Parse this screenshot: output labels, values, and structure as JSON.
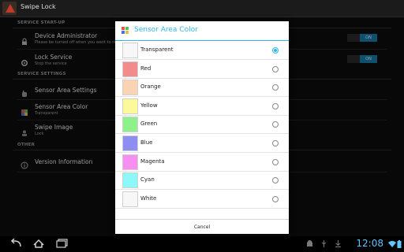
{
  "actionbar": {
    "title": "Swipe Lock"
  },
  "settings": {
    "sections": [
      {
        "label": "SERVICE START-UP"
      },
      {
        "label": "SERVICE SETTINGS"
      },
      {
        "label": "OTHER"
      }
    ],
    "items": [
      {
        "title": "Device Administrator",
        "summary": "Please be turned off when you want to re",
        "toggle": "ON",
        "icon": "lock-icon"
      },
      {
        "title": "Lock Service",
        "summary": "Stop the service",
        "toggle": "ON",
        "icon": "gear-icon"
      },
      {
        "title": "Sensor Area Settings",
        "summary": "",
        "icon": "hand-icon"
      },
      {
        "title": "Sensor Area Color",
        "summary": "Transparent",
        "icon": "palette-icon"
      },
      {
        "title": "Swipe Image",
        "summary": "Lock",
        "icon": "image-icon"
      },
      {
        "title": "Version Information",
        "summary": "",
        "icon": "info-icon"
      }
    ]
  },
  "dialog": {
    "title": "Sensor Area Color",
    "icon": "palette-icon",
    "cancel_label": "Cancel",
    "options": [
      {
        "label": "Transparent",
        "color": "#f7f7f7",
        "selected": true
      },
      {
        "label": "Red",
        "color": "#f28b8b",
        "selected": false
      },
      {
        "label": "Orange",
        "color": "#f9d3b3",
        "selected": false
      },
      {
        "label": "Yellow",
        "color": "#fbf99a",
        "selected": false
      },
      {
        "label": "Green",
        "color": "#8ef28b",
        "selected": false
      },
      {
        "label": "Blue",
        "color": "#8e8ef2",
        "selected": false
      },
      {
        "label": "Magenta",
        "color": "#f78ef2",
        "selected": false
      },
      {
        "label": "Cyan",
        "color": "#8ef7f7",
        "selected": false
      },
      {
        "label": "White",
        "color": "#f7f7f7",
        "selected": false
      }
    ]
  },
  "statusbar": {
    "time": "12:08"
  }
}
